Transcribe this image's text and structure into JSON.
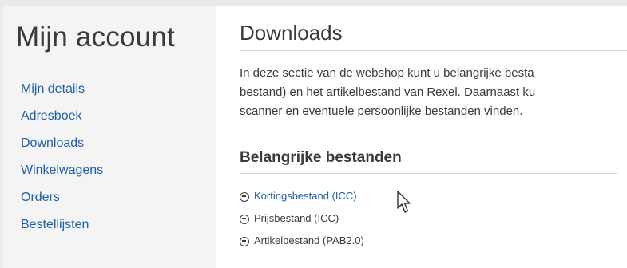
{
  "sidebar": {
    "title": "Mijn account",
    "items": [
      {
        "label": "Mijn details"
      },
      {
        "label": "Adresboek"
      },
      {
        "label": "Downloads"
      },
      {
        "label": "Winkelwagens"
      },
      {
        "label": "Orders"
      },
      {
        "label": "Bestellijsten"
      }
    ]
  },
  "main": {
    "title": "Downloads",
    "intro_lines": [
      "In deze sectie van de webshop kunt u belangrijke besta",
      "bestand) en het artikelbestand van Rexel. Daarnaast ku",
      "scanner en eventuele persoonlijke bestanden vinden."
    ],
    "section": {
      "title": "Belangrijke bestanden",
      "files": [
        {
          "label": "Kortingsbestand (ICC)",
          "icon": "plus-circle-icon"
        },
        {
          "label": "Prijsbestand (ICC)",
          "icon": "plus-circle-icon"
        },
        {
          "label": "Artikelbestand (PAB2.0)",
          "icon": "plus-circle-icon"
        }
      ]
    }
  },
  "colors": {
    "link": "#1b5fa6",
    "text": "#3a3a3a",
    "sidebar_bg": "#f4f4f4",
    "content_bg": "#ffffff"
  }
}
